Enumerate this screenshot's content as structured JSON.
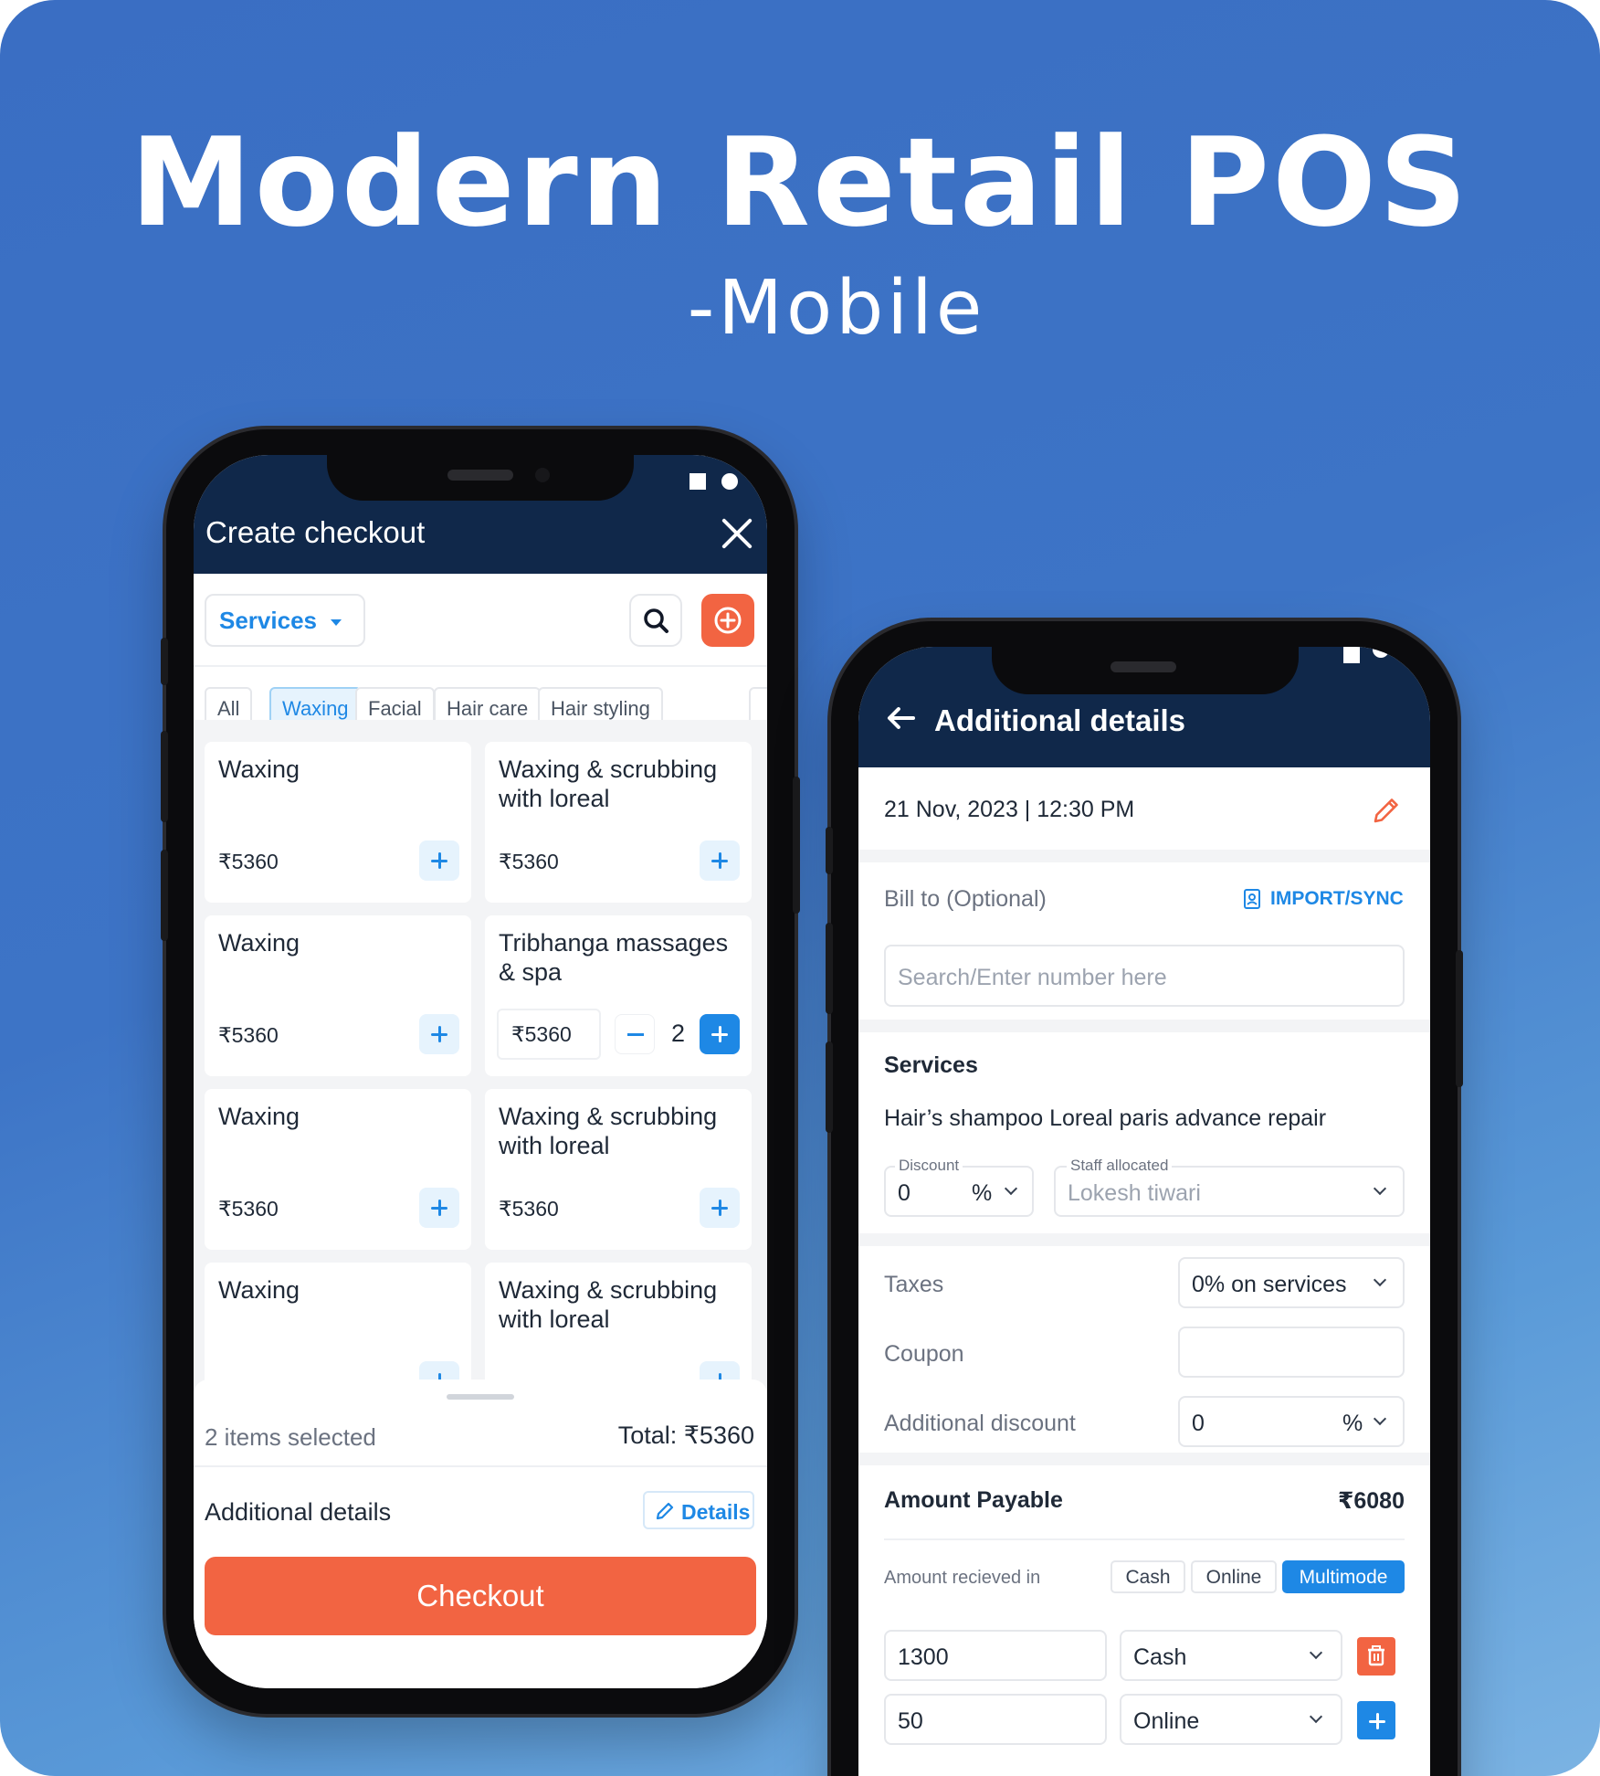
{
  "headline": "Modern Retail POS",
  "subline": "-Mobile",
  "colors": {
    "navy": "#10284a",
    "accent_orange": "#f26442",
    "accent_blue": "#1e88e5",
    "bg_blue": "#3d74c6"
  },
  "checkout": {
    "title": "Create checkout",
    "close_icon": "close-icon",
    "category_dropdown": "Services",
    "chips": [
      "All",
      "Waxing",
      "Facial",
      "Hair care",
      "Hair styling"
    ],
    "active_chip": "Waxing",
    "cards": [
      {
        "name": "Waxing",
        "price": "₹5360"
      },
      {
        "name": "Waxing & scrubbing with loreal",
        "price": "₹5360"
      },
      {
        "name": "Waxing",
        "price": "₹5360"
      },
      {
        "name": "Tribhanga massages & spa",
        "price": "₹5360",
        "qty": "2"
      },
      {
        "name": "Waxing",
        "price": "₹5360"
      },
      {
        "name": "Waxing & scrubbing with loreal",
        "price": "₹5360"
      },
      {
        "name": "Waxing",
        "price": ""
      },
      {
        "name": "Waxing & scrubbing with loreal",
        "price": ""
      }
    ],
    "selected_count": "2 items selected",
    "total": "Total: ₹5360",
    "additional_details_label": "Additional details",
    "details_button": "Details",
    "checkout_button": "Checkout"
  },
  "details": {
    "title": "Additional details",
    "datetime": "21 Nov, 2023 | 12:30 PM",
    "bill_to_label": "Bill to (Optional)",
    "import_sync": "IMPORT/SYNC",
    "bill_to_placeholder": "Search/Enter number here",
    "services_heading": "Services",
    "service_name": "Hair’s shampoo Loreal paris advance repair",
    "discount_label": "Discount",
    "discount_value": "0",
    "discount_unit": "%",
    "staff_label": "Staff allocated",
    "staff_value": "Lokesh tiwari",
    "taxes_label": "Taxes",
    "taxes_value": "0% on services",
    "coupon_label": "Coupon",
    "coupon_value": "",
    "add_discount_label": "Additional discount",
    "add_discount_value": "0",
    "add_discount_unit": "%",
    "amount_payable_label": "Amount Payable",
    "amount_payable_value": "₹6080",
    "amount_received_label": "Amount recieved in",
    "modes": [
      "Cash",
      "Online",
      "Multimode"
    ],
    "active_mode": "Multimode",
    "payments": [
      {
        "amount": "1300",
        "mode": "Cash"
      },
      {
        "amount": "50",
        "mode": "Online"
      }
    ]
  }
}
